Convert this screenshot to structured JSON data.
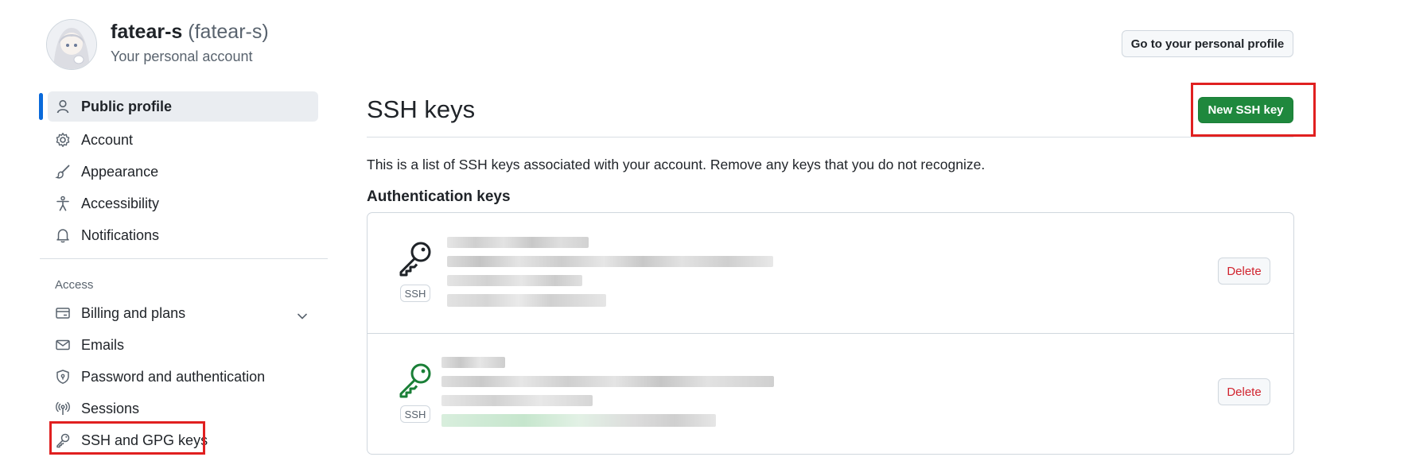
{
  "account": {
    "username": "fatear-s",
    "login": "(fatear-s)",
    "subtitle": "Your personal account",
    "profile_button": "Go to your personal profile"
  },
  "sidebar": {
    "items": [
      {
        "label": "Public profile",
        "icon": "person-icon",
        "active": true
      },
      {
        "label": "Account",
        "icon": "gear-icon"
      },
      {
        "label": "Appearance",
        "icon": "paintbrush-icon"
      },
      {
        "label": "Accessibility",
        "icon": "accessibility-icon"
      },
      {
        "label": "Notifications",
        "icon": "bell-icon"
      }
    ],
    "access_heading": "Access",
    "access_items": [
      {
        "label": "Billing and plans",
        "icon": "credit-card-icon",
        "expandable": true
      },
      {
        "label": "Emails",
        "icon": "mail-icon"
      },
      {
        "label": "Password and authentication",
        "icon": "shield-lock-icon"
      },
      {
        "label": "Sessions",
        "icon": "broadcast-icon"
      },
      {
        "label": "SSH and GPG keys",
        "icon": "key-icon",
        "highlighted": true
      }
    ]
  },
  "main": {
    "title": "SSH keys",
    "new_key_button": "New SSH key",
    "description": "This is a list of SSH keys associated with your account. Remove any keys that you do not recognize.",
    "section_title": "Authentication keys",
    "keys": [
      {
        "badge": "SSH",
        "delete_label": "Delete",
        "icon_color": "#1f2328",
        "details_obscured": true
      },
      {
        "badge": "SSH",
        "delete_label": "Delete",
        "icon_color": "#1a7f37",
        "details_obscured": true
      }
    ]
  },
  "colors": {
    "accent": "#0969da",
    "primary_button": "#1f883d",
    "danger": "#d1242f",
    "highlight_box": "#e02020"
  }
}
